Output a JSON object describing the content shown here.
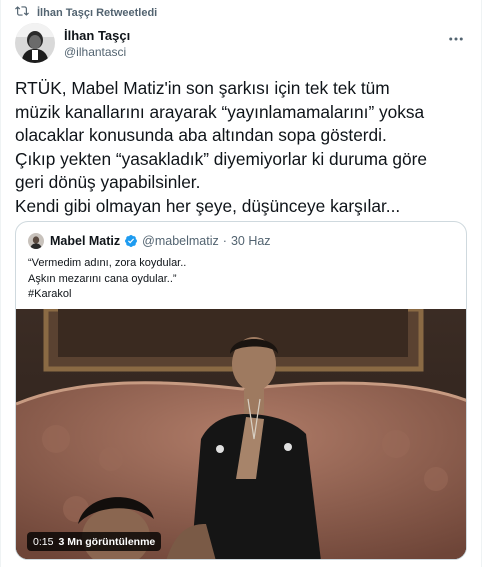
{
  "retweet": {
    "label": "İlhan Taşçı Retweetledi",
    "icon": "retweet-icon"
  },
  "author": {
    "name": "İlhan Taşçı",
    "handle": "@ilhantasci"
  },
  "tweet": {
    "lines": [
      "RTÜK, Mabel Matiz'in son şarkısı için tek tek tüm",
      "müzik kanallarını arayarak “yayınlamamalarını” yoksa",
      "olacaklar konusunda aba altından sopa gösterdi.",
      "Çıkıp yekten “yasakladık” diyemiyorlar ki duruma göre",
      "geri dönüş yapabilsinler.",
      "Kendi gibi olmayan her şeye, düşünceye karşılar..."
    ]
  },
  "quoted": {
    "name": "Mabel Matiz",
    "handle": "@mabelmatiz",
    "separator": "·",
    "date": "30 Haz",
    "lines": [
      "“Vermedim adını, zora koydular..",
      "Aşkın mezarını cana oydular..”",
      "#Karakol"
    ],
    "video": {
      "time": "0:15",
      "views": "3 Mn görüntülenme"
    }
  },
  "colors": {
    "text": "#0f1419",
    "secondary": "#536471",
    "border": "#cfd9de",
    "verified": "#1d9bf0"
  }
}
